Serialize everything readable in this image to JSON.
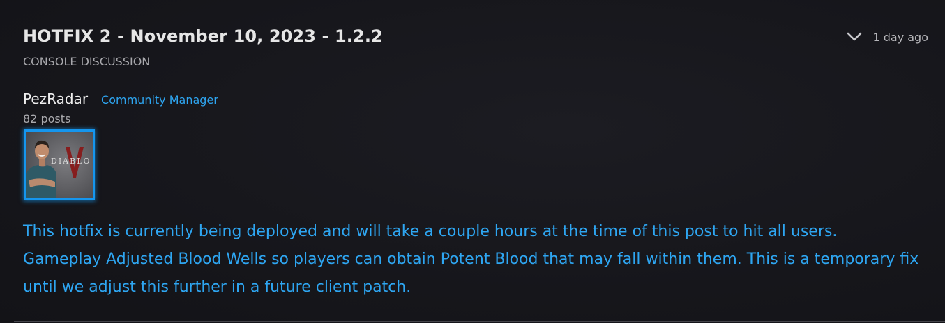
{
  "post": {
    "title": "HOTFIX 2 - November 10, 2023 - 1.2.2",
    "category": "CONSOLE DISCUSSION",
    "timestamp": "1 day ago",
    "expand_icon": "chevron-down-icon"
  },
  "author": {
    "name": "PezRadar",
    "role": "Community Manager",
    "post_count": "82 posts",
    "avatar_logo_text": "DIABLO IV"
  },
  "body": {
    "paragraph_1": "This hotfix is currently being deployed and will take a couple hours at the time of this post to hit all users.",
    "paragraph_2": "Gameplay Adjusted Blood Wells so players can obtain Potent Blood that may fall within them. This is a temporary fix until we adjust this further in a future client patch."
  },
  "colors": {
    "background": "#17171c",
    "accent": "#2ea6f2",
    "avatar_border": "#1596ee"
  }
}
